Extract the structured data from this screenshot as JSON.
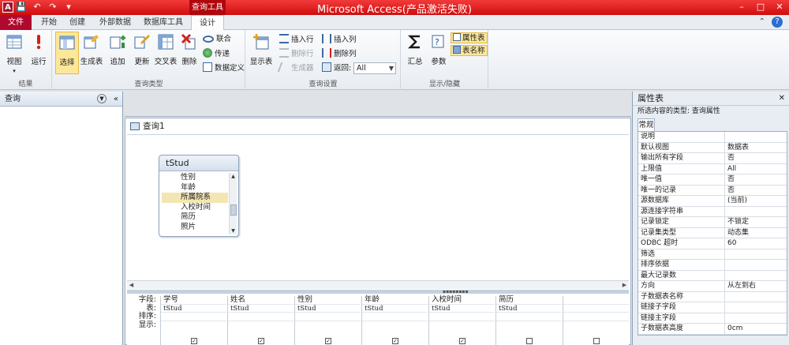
{
  "window": {
    "title": "Microsoft Access(产品激活失败)",
    "app_icon": "A",
    "context_tab": "查询工具"
  },
  "ribbon_tabs": [
    {
      "label": "文件"
    },
    {
      "label": "开始"
    },
    {
      "label": "创建"
    },
    {
      "label": "外部数据"
    },
    {
      "label": "数据库工具"
    },
    {
      "label": "设计"
    }
  ],
  "ribbon": {
    "results": {
      "label": "结果",
      "view": "视图",
      "run": "运行"
    },
    "query_type": {
      "label": "查询类型",
      "select": "选择",
      "make_table": "生成表",
      "append": "追加",
      "update": "更新",
      "crosstab": "交叉表",
      "delete": "删除",
      "union": "联合",
      "passthrough": "传递",
      "data_definition": "数据定义"
    },
    "query_setup": {
      "label": "查询设置",
      "show_table": "显示表",
      "insert_rows": "插入行",
      "delete_rows": "删除行",
      "builder": "生成器",
      "insert_columns": "插入列",
      "delete_columns": "删除列",
      "return_label": "返回:",
      "return_value": "All"
    },
    "show_hide": {
      "label": "显示/隐藏",
      "totals": "汇总",
      "parameters": "参数",
      "property_sheet": "属性表",
      "table_names": "表名称"
    }
  },
  "nav": {
    "title": "查询"
  },
  "document": {
    "tab_title": "查询1",
    "table_box": {
      "title": "tStud",
      "fields": [
        "性别",
        "年龄",
        "所属院系",
        "入校时间",
        "简历",
        "照片"
      ],
      "highlighted": "所属院系"
    },
    "grid": {
      "row_labels": [
        "字段:",
        "表:",
        "排序:",
        "显示:"
      ],
      "columns": [
        {
          "field": "学号",
          "table": "tStud"
        },
        {
          "field": "姓名",
          "table": "tStud"
        },
        {
          "field": "性别",
          "table": "tStud"
        },
        {
          "field": "年龄",
          "table": "tStud"
        },
        {
          "field": "入校时间",
          "table": "tStud"
        },
        {
          "field": "简历",
          "table": "tStud"
        },
        {
          "field": "",
          "table": ""
        }
      ]
    }
  },
  "property_sheet": {
    "title": "属性表",
    "selection_type": "所选内容的类型: 查询属性",
    "tab": "常规",
    "rows": [
      {
        "k": "说明",
        "v": ""
      },
      {
        "k": "默认视图",
        "v": "数据表"
      },
      {
        "k": "输出所有字段",
        "v": "否"
      },
      {
        "k": "上限值",
        "v": "All"
      },
      {
        "k": "唯一值",
        "v": "否"
      },
      {
        "k": "唯一的记录",
        "v": "否"
      },
      {
        "k": "源数据库",
        "v": "(当前)"
      },
      {
        "k": "源连接字符串",
        "v": ""
      },
      {
        "k": "记录锁定",
        "v": "不锁定"
      },
      {
        "k": "记录集类型",
        "v": "动态集"
      },
      {
        "k": "ODBC 超时",
        "v": "60"
      },
      {
        "k": "筛选",
        "v": ""
      },
      {
        "k": "排序依据",
        "v": ""
      },
      {
        "k": "最大记录数",
        "v": ""
      },
      {
        "k": "方向",
        "v": "从左到右"
      },
      {
        "k": "子数据表名称",
        "v": ""
      },
      {
        "k": "链接子字段",
        "v": ""
      },
      {
        "k": "链接主字段",
        "v": ""
      },
      {
        "k": "子数据表高度",
        "v": "0cm"
      }
    ]
  }
}
